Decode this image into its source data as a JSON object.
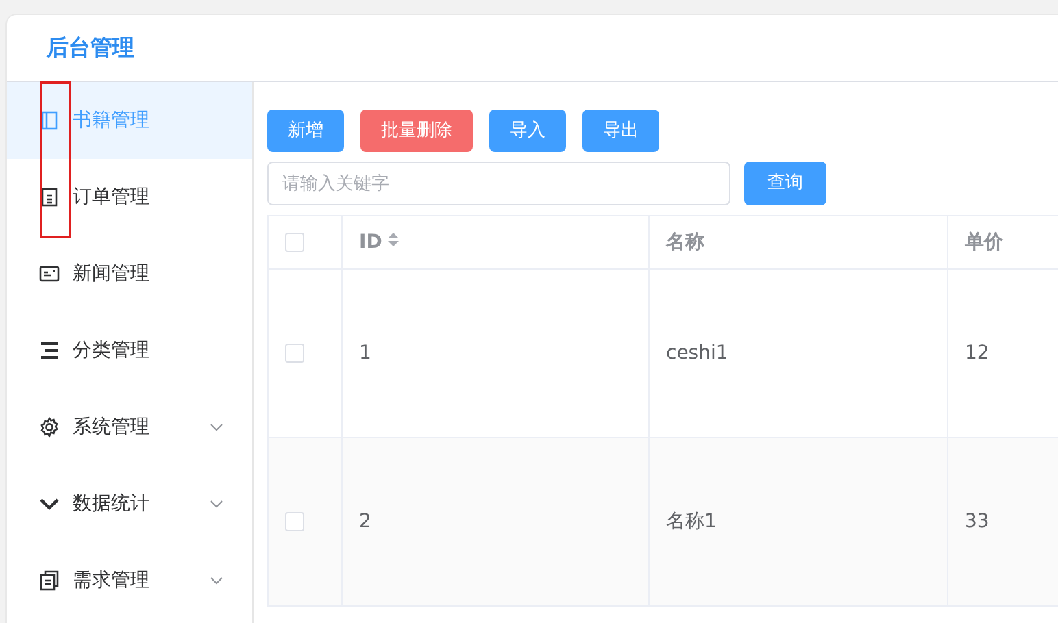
{
  "app_title": "后台管理",
  "menu": [
    {
      "label": "书籍管理",
      "kind": "book",
      "selected": true,
      "expandable": false
    },
    {
      "label": "订单管理",
      "kind": "document",
      "selected": false,
      "expandable": false
    },
    {
      "label": "新闻管理",
      "kind": "news",
      "selected": false,
      "expandable": false
    },
    {
      "label": "分类管理",
      "kind": "list",
      "selected": false,
      "expandable": false
    },
    {
      "label": "系统管理",
      "kind": "gear",
      "selected": false,
      "expandable": true
    },
    {
      "label": "数据统计",
      "kind": "chevron",
      "selected": false,
      "expandable": true
    },
    {
      "label": "需求管理",
      "kind": "copy",
      "selected": false,
      "expandable": true
    }
  ],
  "toolbar": [
    {
      "label": "新增",
      "kind": "primary"
    },
    {
      "label": "批量删除",
      "kind": "danger"
    },
    {
      "label": "导入",
      "kind": "primary"
    },
    {
      "label": "导出",
      "kind": "primary"
    }
  ],
  "search": {
    "placeholder": "请输入关键字",
    "button": "查询"
  },
  "table": {
    "all_checked": false,
    "columns": [
      {
        "label": "ID",
        "sortable": true
      },
      {
        "label": "名称",
        "sortable": false
      },
      {
        "label": "单价",
        "sortable": false
      }
    ],
    "rows": [
      {
        "checked": false,
        "cells": [
          "1",
          "ceshi1",
          "12"
        ]
      },
      {
        "checked": false,
        "cells": [
          "2",
          "名称1",
          "33"
        ]
      }
    ]
  }
}
